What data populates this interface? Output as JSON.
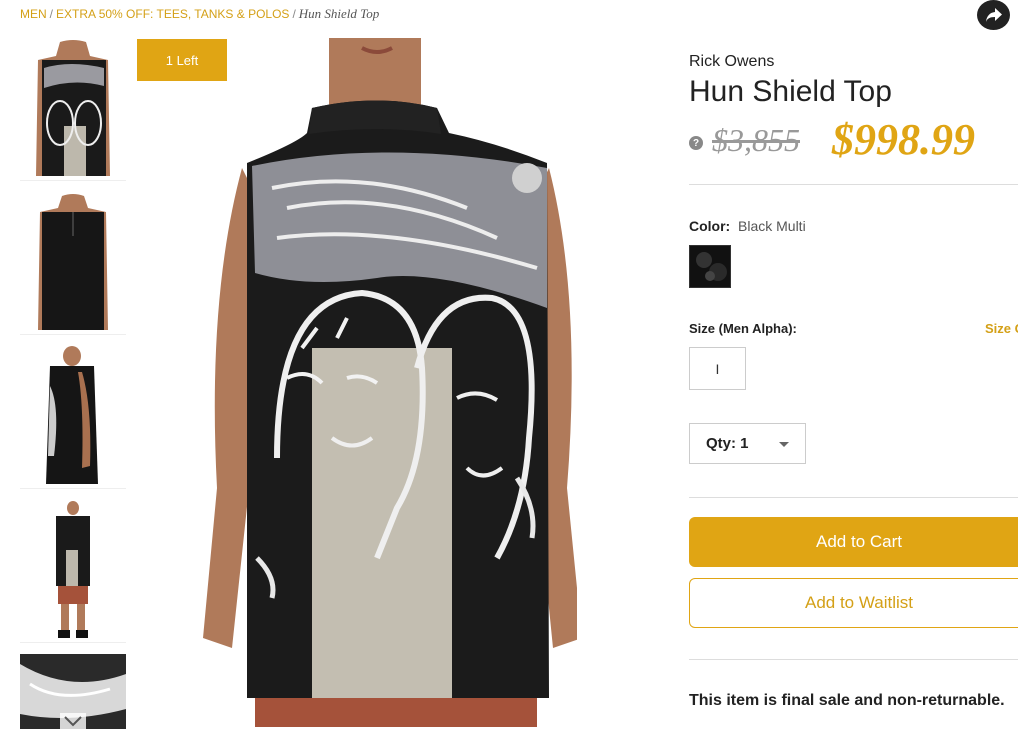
{
  "breadcrumb": {
    "item1": "MEN",
    "item2": "EXTRA 50% OFF: TEES, TANKS & POLOS",
    "current": "Hun Shield Top",
    "separator": "/"
  },
  "badge": {
    "label": "1 Left"
  },
  "product": {
    "brand": "Rick Owens",
    "title": "Hun Shield Top",
    "original_price": "$3,855",
    "sale_price": "$998.99",
    "help_icon": "?"
  },
  "color": {
    "label": "Color:",
    "value": "Black Multi"
  },
  "size": {
    "label": "Size (Men Alpha):",
    "guide_label": "Size G",
    "option": "I"
  },
  "quantity": {
    "label": "Qty: 1"
  },
  "actions": {
    "add_to_cart": "Add to Cart",
    "add_to_waitlist": "Add to Waitlist"
  },
  "notice": "This item is final sale and non-returnable.",
  "colors": {
    "accent": "#e0a514",
    "accent_text": "#d4a017",
    "strike": "#999999"
  },
  "icons": {
    "share": "share-arrow-icon",
    "help": "question-icon",
    "thumb_down": "chevron-down-icon",
    "qty": "chevron-down-icon"
  }
}
